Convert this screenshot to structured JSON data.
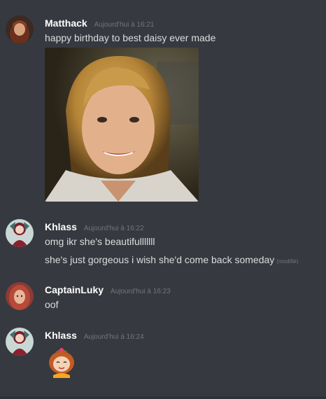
{
  "messages": [
    {
      "username": "Matthack",
      "timestamp": "Aujourd'hui à 16:21",
      "lines": [
        "happy birthday to best daisy ever made"
      ]
    },
    {
      "username": "Khlass",
      "timestamp": "Aujourd'hui à 16:22",
      "lines": [
        "omg ikr she's beautifulllllll",
        "she's just gorgeous i wish she'd come back someday"
      ],
      "edited_label": "(modifié)"
    },
    {
      "username": "CaptainLuky",
      "timestamp": "Aujourd'hui à 16:23",
      "lines": [
        "oof"
      ]
    },
    {
      "username": "Khlass",
      "timestamp": "Aujourd'hui à 16:24",
      "lines": []
    }
  ],
  "colors": {
    "background": "#36393f",
    "username": "#ffffff",
    "text": "#dcddde",
    "timestamp": "#72767d"
  }
}
